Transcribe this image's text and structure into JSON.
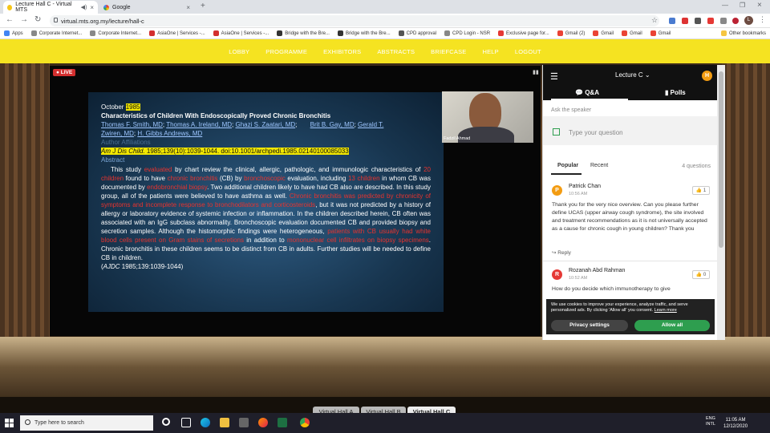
{
  "browser": {
    "tabs": [
      {
        "title": "Lecture Hall C - Virtual MTS",
        "active": true
      },
      {
        "title": "Google",
        "active": false
      }
    ],
    "url": "virtual.mts.org.my/lecture/hall-c",
    "bookmarks": [
      "Apps",
      "Corporate Internet...",
      "Corporate Internet...",
      "AsiaOne | Services -...",
      "AsiaOne | Services -...",
      "Bridge with the Bre...",
      "Bridge with the Bre...",
      "CPD approval",
      "CPD Login - NSR",
      "Exclusive page for...",
      "Gmail (2)",
      "Gmail",
      "Gmail",
      "Gmail",
      "Other bookmarks"
    ],
    "profile_initial": "L"
  },
  "site_nav": [
    "LOBBY",
    "PROGRAMME",
    "EXHIBITORS",
    "ABSTRACTS",
    "BRIEFCASE",
    "HELP",
    "LOGOUT"
  ],
  "video": {
    "live_label": "LIVE",
    "speaker_name": "Fadzil Ahmad",
    "slide": {
      "date_prefix": "October",
      "year": "1985",
      "title": "Characteristics of Children With Endoscopically Proved Chronic Bronchitis",
      "authors_line1": [
        "Thomas F. Smith, MD",
        "Thomas A. Ireland, MD",
        "Ghazi S. Zaatari, MD",
        "Brit B. Gay, MD",
        "Gerald T."
      ],
      "authors_line2": [
        "Zwiren, MD",
        "H. Gibbs Andrews, MD"
      ],
      "author_affiliations": "Author Affiliations",
      "citation_journal": "Am J Dis Child.",
      "citation_rest": " 1985;139(10):1039-1044. doi:10.1001/archpedi.1985.02140100085033",
      "abstract_heading": "Abstract",
      "abstract_segments": [
        {
          "t": "This study ",
          "red": false
        },
        {
          "t": "evaluated",
          "red": true
        },
        {
          "t": " by chart review the clinical, allergic, pathologic, and immunologic characteristics of ",
          "red": false
        },
        {
          "t": "20 children",
          "red": true
        },
        {
          "t": " found to have ",
          "red": false
        },
        {
          "t": "chronic bronchitis",
          "red": true
        },
        {
          "t": " (CB) by ",
          "red": false
        },
        {
          "t": "bronchoscopic",
          "red": true
        },
        {
          "t": " evaluation, including ",
          "red": false
        },
        {
          "t": "13 children",
          "red": true
        },
        {
          "t": " in whom CB was documented by ",
          "red": false
        },
        {
          "t": "endobronchial biopsy",
          "red": true
        },
        {
          "t": ". Two additional children likely to have had CB also are described. In this study group, all of the patients were believed to have asthma as well. ",
          "red": false
        },
        {
          "t": "Chronic bronchitis was predicted by chronicity of symptoms and incomplete response to bronchodilators and corticosteroids",
          "red": true
        },
        {
          "t": ", but it was not predicted by a history of allergy or laboratory evidence of systemic infection or inflammation. In the children described herein, CB often was associated with an IgG subclass abnormality. Bronchoscopic evaluation documented CB and provided biopsy and secretion samples. Although the histomorphic findings were heterogeneous, ",
          "red": false
        },
        {
          "t": "patients with CB usually had white blood cells present on Gram stains of secretions",
          "red": true
        },
        {
          "t": " in addition to ",
          "red": false
        },
        {
          "t": "mononuclear cell infiltrates on biopsy specimens",
          "red": true
        },
        {
          "t": ". Chronic bronchitis in these children seems to be distinct from CB in adults. Further studies will be needed to define CB in children.",
          "red": false
        }
      ],
      "footnote_italic": "AJDC",
      "footnote_rest": " 1985;139:1039-1044)"
    }
  },
  "qa_panel": {
    "title": "Lecture C",
    "user_initial": "H",
    "tabs": [
      "Q&A",
      "Polls"
    ],
    "ask_label": "Ask the speaker",
    "ask_placeholder": "Type your question",
    "sort_tabs": [
      "Popular",
      "Recent"
    ],
    "question_count": "4 questions",
    "questions": [
      {
        "initial": "P",
        "avatar_color": "#f39c12",
        "name": "Patrick Chan",
        "time": "10:56 AM",
        "likes": "1",
        "text": "Thank you for the very nice overview. Can you please further define UCAS (upper airway cough syndrome), the site involved and treatment recommendations as it is not universally accepted as a cause for chronic cough in young children? Thank you",
        "reply_label": "Reply"
      },
      {
        "initial": "R",
        "avatar_color": "#e53935",
        "name": "Rozanah Abd Rahman",
        "time": "10:52 AM",
        "likes": "0",
        "text": "How do you decide which immunotherapy to give"
      }
    ],
    "cookie": {
      "text": "We use cookies to improve your experience, analyze traffic, and serve personalized ads. By clicking 'Allow all' you consent.",
      "learn_more": "Learn more",
      "privacy_button": "Privacy settings",
      "allow_button": "Allow all",
      "allow_color": "#2e9e4f"
    }
  },
  "hall_tabs": [
    {
      "label": "Virtual Hall A",
      "active": false
    },
    {
      "label": "Virtual Hall B",
      "active": false
    },
    {
      "label": "Virtual Hall C",
      "active": true
    }
  ],
  "taskbar": {
    "search_placeholder": "Type here to search",
    "language": "ENG",
    "locale": "INTL",
    "time": "11:05 AM",
    "date": "12/12/2020"
  }
}
